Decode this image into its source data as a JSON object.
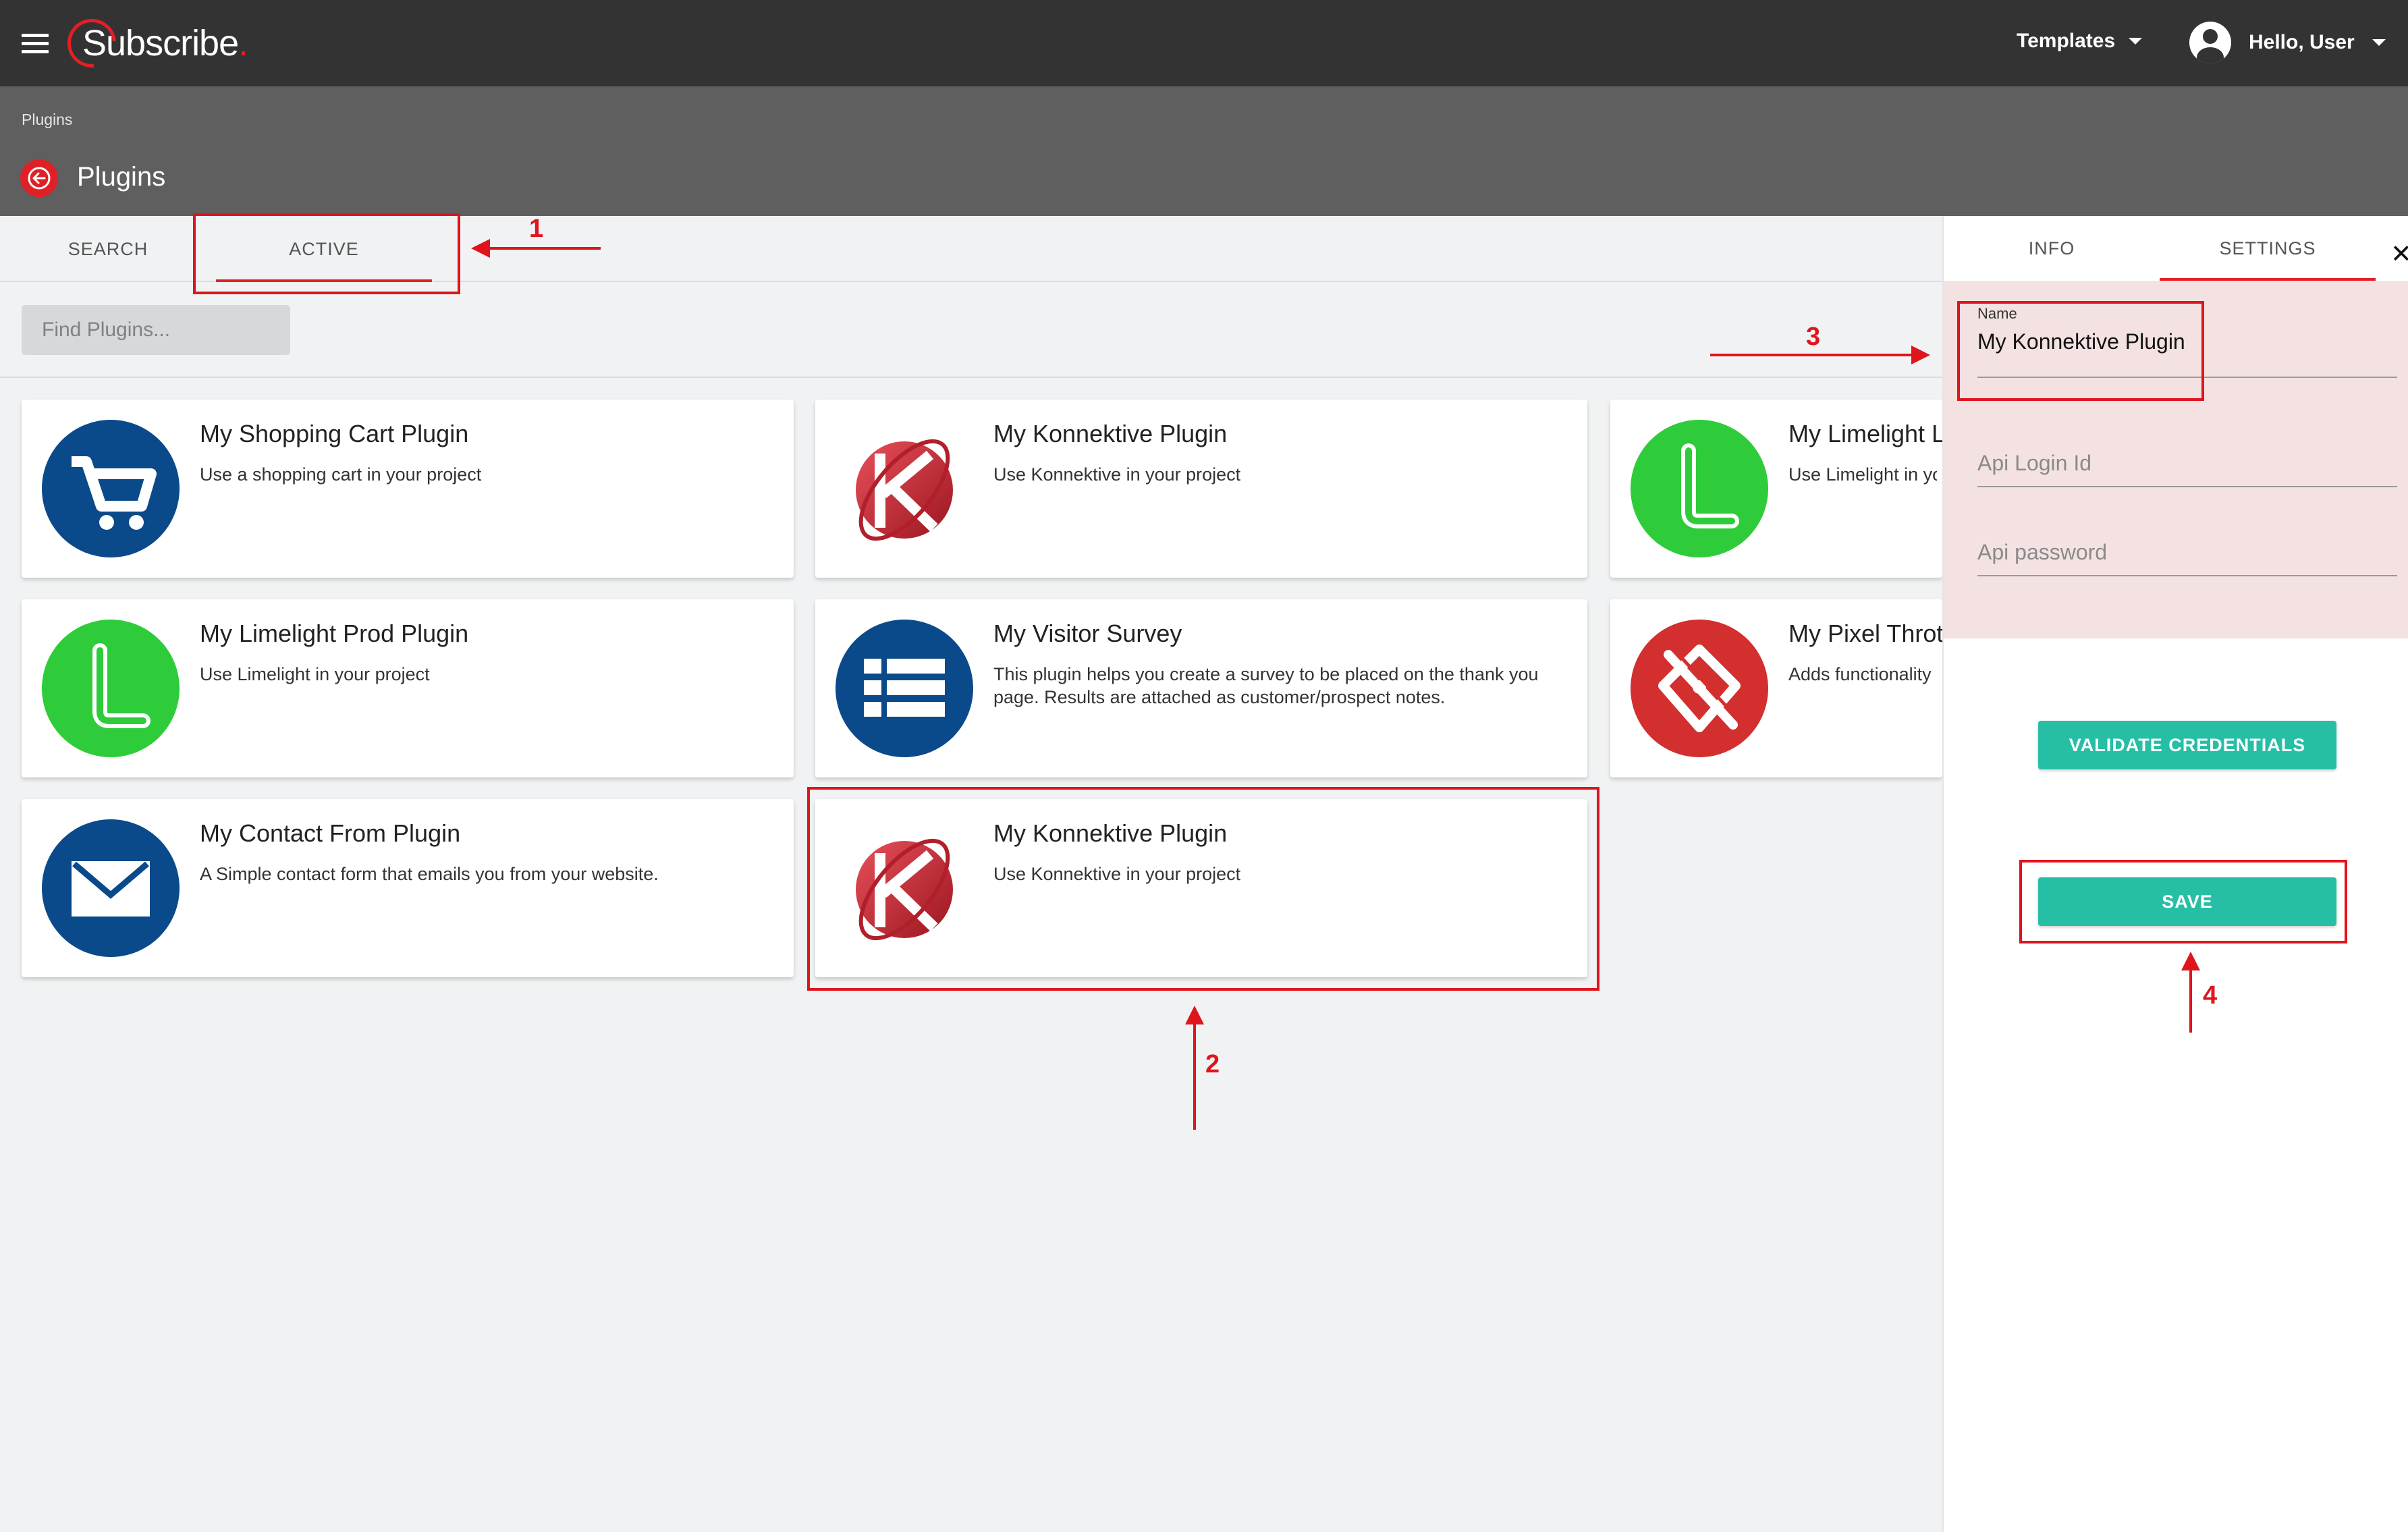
{
  "header": {
    "logo_text": "Subscribe",
    "logo_dot": ".",
    "templates_label": "Templates",
    "user_label": "Hello, User"
  },
  "subheader": {
    "breadcrumb": "Plugins",
    "title": "Plugins"
  },
  "tabs": {
    "search": "SEARCH",
    "active": "ACTIVE"
  },
  "search": {
    "placeholder": "Find Plugins..."
  },
  "cards": [
    {
      "title": "My Shopping Cart Plugin",
      "desc": "Use a shopping cart in your project",
      "icon": "shopping-cart-icon"
    },
    {
      "title": "My Konnektive Plugin",
      "desc": "Use Konnektive in your project",
      "icon": "konnektive-logo-icon"
    },
    {
      "title": "My Limelight L",
      "desc": "Use Limelight in yo",
      "icon": "limelight-icon"
    },
    {
      "title": "My Limelight Prod Plugin",
      "desc": "Use Limelight in your project",
      "icon": "limelight-icon"
    },
    {
      "title": "My Visitor Survey",
      "desc": "This plugin helps you create a survey to be placed on the thank you page. Results are attached as customer/prospect notes.",
      "icon": "survey-list-icon"
    },
    {
      "title": "My Pixel Throt",
      "desc": "Adds functionality",
      "icon": "pixel-blocked-icon"
    },
    {
      "title": "My Contact From Plugin",
      "desc": "A Simple contact form that emails you from your website.",
      "icon": "envelope-icon"
    },
    {
      "title": "My Konnektive Plugin",
      "desc": "Use Konnektive in your project",
      "icon": "konnektive-logo-icon"
    }
  ],
  "panel": {
    "tab_info": "INFO",
    "tab_settings": "SETTINGS",
    "close_glyph": "✕",
    "name_label": "Name",
    "name_value": "My Konnektive Plugin",
    "api_login_placeholder": "Api Login Id",
    "api_password_placeholder": "Api password",
    "validate_label": "VALIDATE CREDENTIALS",
    "save_label": "SAVE"
  },
  "annotations": [
    "1",
    "2",
    "3",
    "4"
  ],
  "colors": {
    "topbar": "#333333",
    "subheader": "#5f5f5f",
    "accent_red": "#e02027",
    "teal_button": "#26bfa6",
    "form_bg": "#f4e2e2",
    "annotation_red": "#e0141c"
  }
}
